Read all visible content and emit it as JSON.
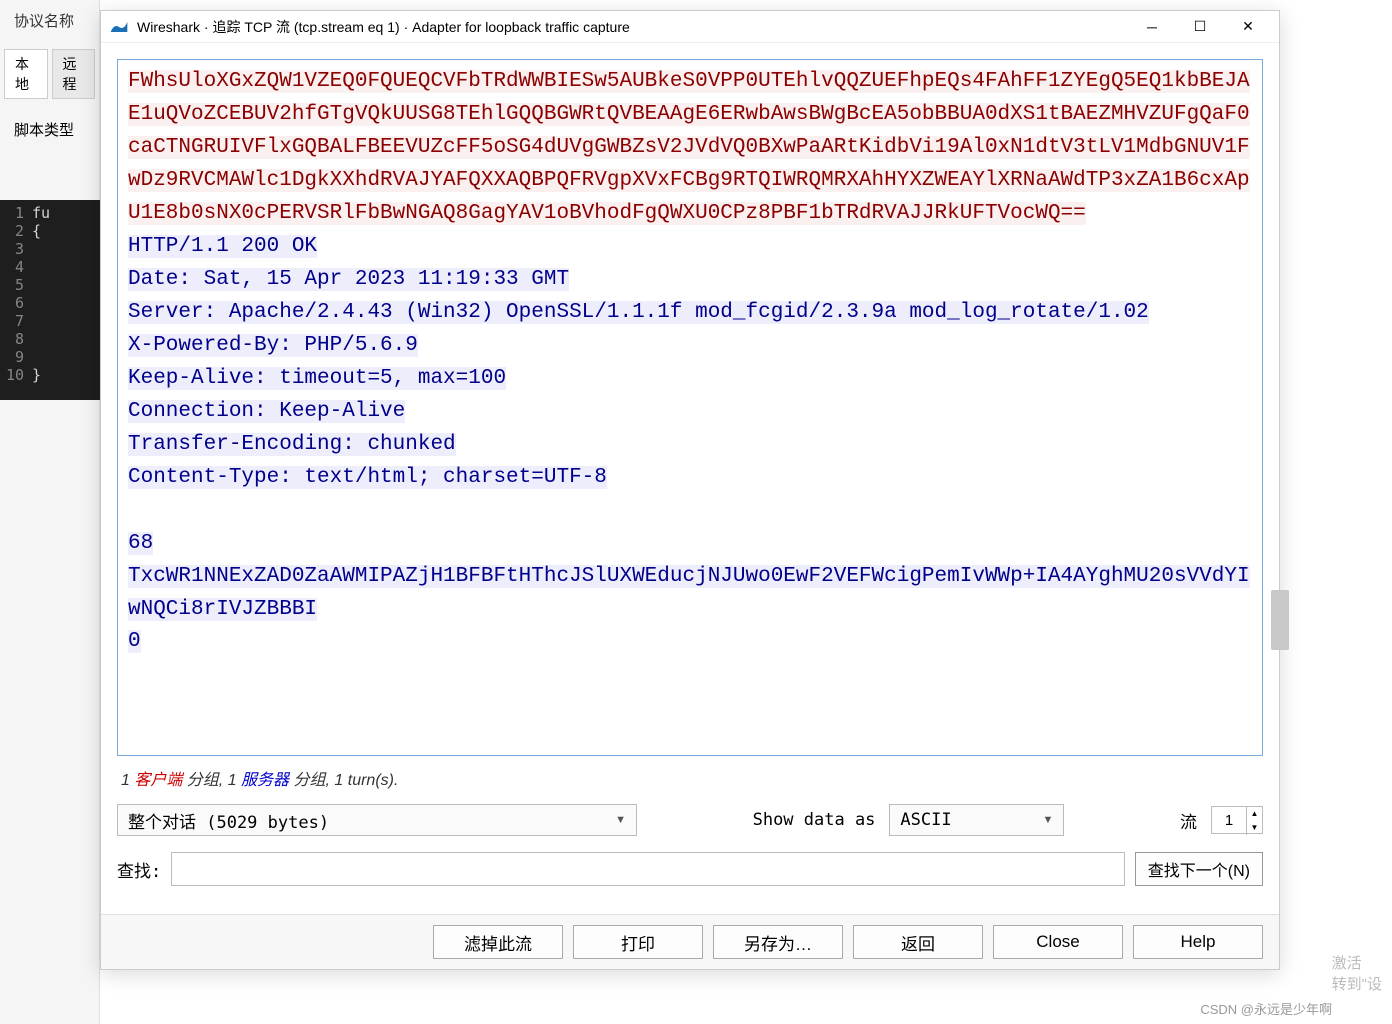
{
  "bg": {
    "label1": "协议名称",
    "tab1": "本地",
    "tab2": "远程",
    "label2": "脚本类型",
    "code_lines": [
      "fu",
      "{",
      "",
      "",
      "",
      "",
      "",
      "",
      "",
      "}"
    ]
  },
  "dialog": {
    "title": "Wireshark · 追踪 TCP 流 (tcp.stream eq 1) · Adapter for loopback traffic capture",
    "request_text": "FWhsUloXGxZQW1VZEQ0FQUEQCVFbTRdWWBIESw5AUBkeS0VPP0UTEhlvQQZUEFhpEQs4FAhFF1ZYEgQ5EQ1kbBEJAE1uQVoZCEBUV2hfGTgVQkUUSG8TEhlGQQBGWRtQVBEAAgE6ERwbAwsBWgBcEA5obBBUA0dXS1tBAEZMHVZUFgQaF0caCTNGRUIVFlxGQBALFBEEVUZcFF5oSG4dUVgGWBZsV2JVdVQ0BXwPaARtKidbVi19Al0xN1dtV3tLV1MdbGNUV1FwDz9RVCMAWlc1DgkXXhdRVAJYAFQXXAQBPQFRVgpXVxFCBg9RTQIWRQMRXAhHYXZWEAYlXRNaAWdTP3xZA1B6cxApU1E8b0sNX0cPERVSRlFbBwNGAQ8GagYAV1oBVhodFgQWXU0CPz8PBF1bTRdRVAJJRkUFTVocWQ==",
    "response_headers": [
      "HTTP/1.1 200 OK",
      "Date: Sat, 15 Apr 2023 11:19:33 GMT",
      "Server: Apache/2.4.43 (Win32) OpenSSL/1.1.1f mod_fcgid/2.3.9a mod_log_rotate/1.02",
      "X-Powered-By: PHP/5.6.9",
      "Keep-Alive: timeout=5, max=100",
      "Connection: Keep-Alive",
      "Transfer-Encoding: chunked",
      "Content-Type: text/html; charset=UTF-8"
    ],
    "response_body": [
      "68",
      "TxcWR1NNExZAD0ZaAWMIPAZjH1BFBFtHThcJSlUXWEducjNJUwo0EwF2VEFWcigPemIvWWp+IA4AYghMU20sVVdYIwNQCi8rIVJZBBBI",
      "0"
    ],
    "stats_prefix": "1 ",
    "stats_client": "客户端",
    "stats_mid1": " 分组, 1 ",
    "stats_server": "服务器",
    "stats_mid2": " 分组, 1 turn(s).",
    "conversation_combo": "整个对话 (5029 bytes)",
    "show_as_label": "Show data as",
    "show_as_value": "ASCII",
    "stream_label": "流",
    "stream_value": "1",
    "find_label": "查找:",
    "find_next_btn": "查找下一个(N)",
    "buttons": {
      "filter_out": "滤掉此流",
      "print": "打印",
      "save_as": "另存为…",
      "back": "返回",
      "close": "Close",
      "help": "Help"
    }
  },
  "watermark": {
    "line1": "激活",
    "line2": "转到\"设"
  },
  "csdn": "CSDN @永远是少年啊"
}
